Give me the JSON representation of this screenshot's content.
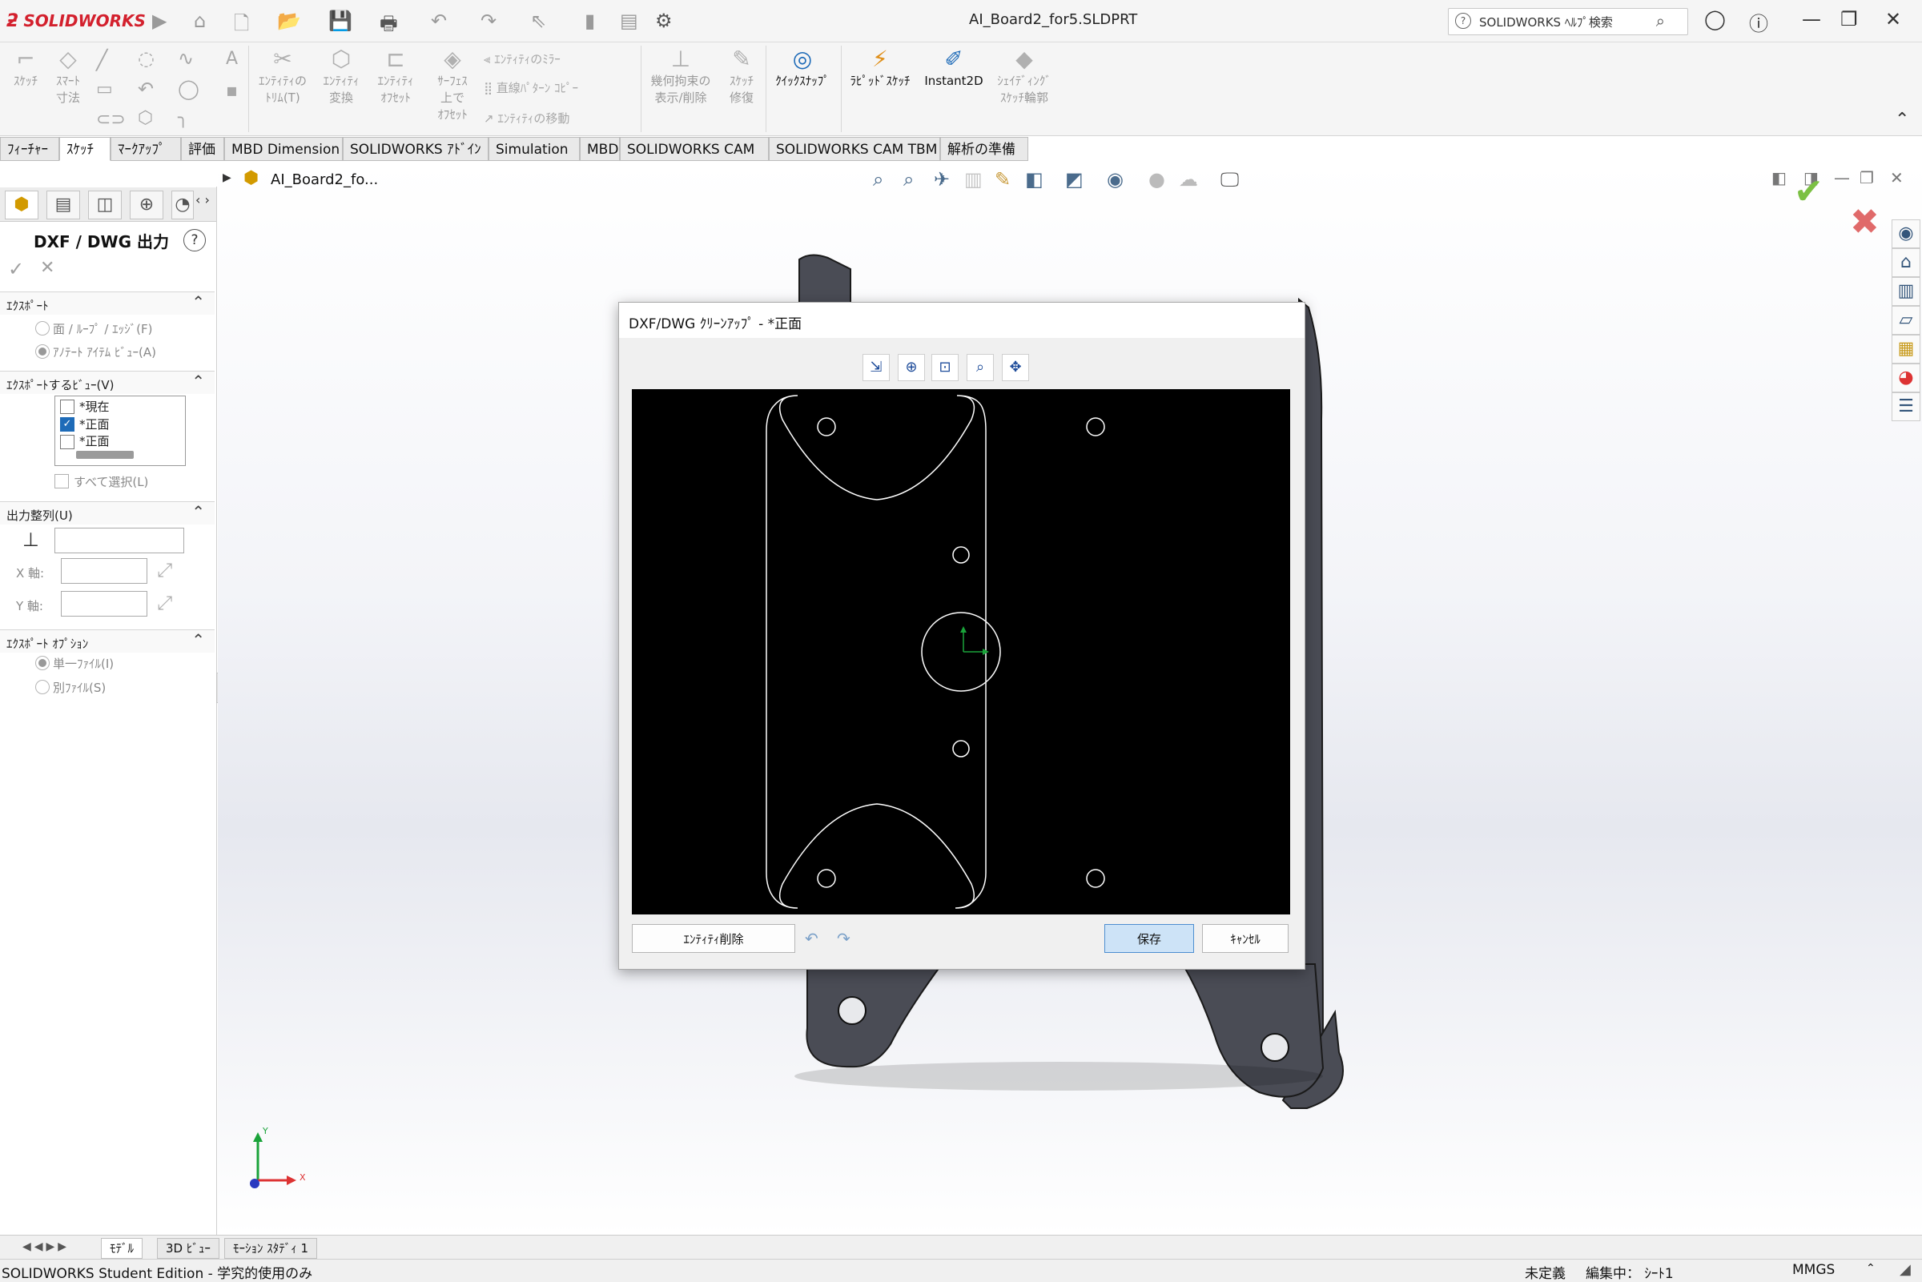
{
  "window": {
    "title": "AI_Board2_for5.SLDPRT",
    "logo_text": "SOLIDWORKS",
    "search_placeholder": "SOLIDWORKS ﾍﾙﾌﾟ検索"
  },
  "commands": {
    "sketch": "ｽｹｯﾁ",
    "smart_dim_1": "ｽﾏｰﾄ",
    "smart_dim_2": "寸法",
    "trim_1": "ｴﾝﾃｨﾃｨの",
    "trim_2": "ﾄﾘﾑ(T)",
    "convert_1": "ｴﾝﾃｨﾃｨ",
    "convert_2": "変換",
    "offset_1": "ｴﾝﾃｨﾃｨ",
    "offset_2": "ｵﾌｾｯﾄ",
    "surface_offset_1": "ｻｰﾌｪｽ",
    "surface_offset_2": "上で",
    "surface_offset_3": "ｵﾌｾｯﾄ",
    "mirror": "ｴﾝﾃｨﾃｨのﾐﾗｰ",
    "linear_pattern": "直線ﾊﾟﾀｰﾝ ｺﾋﾟｰ",
    "move": "ｴﾝﾃｨﾃｨの移動",
    "relations_1": "幾何拘束の",
    "relations_2": "表示/削除",
    "repair_1": "ｽｹｯﾁ",
    "repair_2": "修復",
    "quick_snap": "ｸｲｯｸｽﾅｯﾌﾟ",
    "rapid_sketch": "ﾗﾋﾟｯﾄﾞｽｹｯﾁ",
    "instant2d": "Instant2D",
    "shaded_1": "ｼｪｲﾃﾞｨﾝｸﾞ",
    "shaded_2": "ｽｹｯﾁ輪郭"
  },
  "tabs": [
    "ﾌｨｰﾁｬｰ",
    "ｽｹｯﾁ",
    "ﾏｰｸｱｯﾌﾟ",
    "評価",
    "MBD Dimension",
    "SOLIDWORKS ｱﾄﾞｲﾝ",
    "Simulation",
    "MBD",
    "SOLIDWORKS CAM",
    "SOLIDWORKS CAM TBM",
    "解析の準備"
  ],
  "tree": {
    "item": "AI_Board2_fo..."
  },
  "property_manager": {
    "title": "DXF / DWG 出力",
    "export": {
      "heading": "ｴｸｽﾎﾟｰﾄ",
      "opt_faces": "面 / ﾙｰﾌﾟ / ｴｯｼﾞ(F)",
      "opt_annotation": "ｱﾉﾃｰﾄ ｱｲﾃﾑ ﾋﾞｭｰ(A)"
    },
    "views": {
      "heading": "ｴｸｽﾎﾟｰﾄするﾋﾞｭｰ(V)",
      "items": [
        "*現在",
        "*正面",
        "*正面"
      ],
      "select_all": "すべて選択(L)"
    },
    "alignment": {
      "heading": "出力整列(U)",
      "x_axis": "X 軸:",
      "y_axis": "Y 軸:"
    },
    "options": {
      "heading": "ｴｸｽﾎﾟｰﾄ ｵﾌﾟｼｮﾝ",
      "single_file": "単一ﾌｧｲﾙ(I)",
      "separate_files": "別ﾌｧｲﾙ(S)"
    }
  },
  "dialog": {
    "title": "DXF/DWG ｸﾘｰﾝｱｯﾌﾟ - *正面",
    "delete_entity": "ｴﾝﾃｨﾃｨ削除",
    "save": "保存",
    "cancel": "ｷｬﾝｾﾙ"
  },
  "triad": {
    "x": "X",
    "y": "Y"
  },
  "bottom_tabs": [
    "ﾓﾃﾞﾙ",
    "3D ﾋﾞｭｰ",
    "ﾓｰｼｮﾝ ｽﾀﾃﾞｨ 1"
  ],
  "status": {
    "left": "SOLIDWORKS Student Edition - 学究的使用のみ",
    "definition": "未定義",
    "editing": "編集中： ｼｰﾄ1",
    "units": "MMGS"
  },
  "colors": {
    "accent": "#1e6bb8",
    "brand": "#d3202d",
    "drawing_bg": "#000000",
    "drawing_lines": "#ffffff"
  }
}
